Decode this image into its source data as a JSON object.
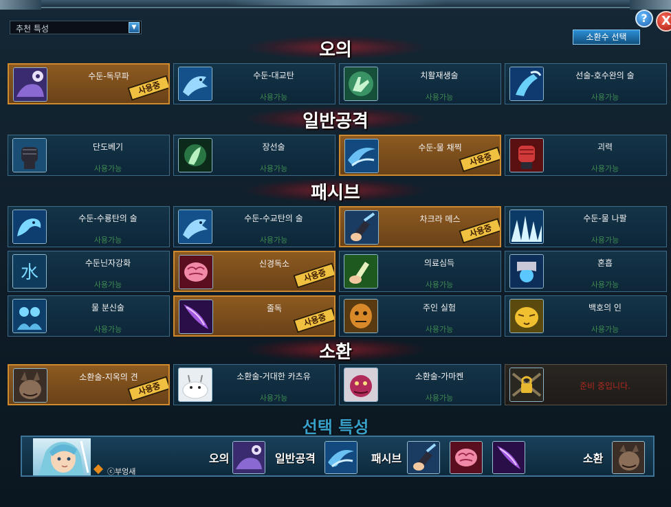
{
  "header": {
    "dropdown_value": "추천 특성",
    "summon_button": "소환수 선택",
    "help_symbol": "?",
    "close_symbol": "X"
  },
  "sections": [
    {
      "title": "오의",
      "cards": [
        {
          "name": "수둔-독무파",
          "status": "사용중",
          "used": true,
          "icon": "purple-yin-yang-icon"
        },
        {
          "name": "수둔-대교탄",
          "status": "사용가능",
          "used": false,
          "icon": "water-shark-icon"
        },
        {
          "name": "치활재생술",
          "status": "사용가능",
          "used": false,
          "icon": "green-healing-hand-icon"
        },
        {
          "name": "선술-호수완의 술",
          "status": "사용가능",
          "used": false,
          "icon": "water-arm-icon"
        }
      ]
    },
    {
      "title": "일반공격",
      "cards": [
        {
          "name": "단도베기",
          "status": "사용가능",
          "used": false,
          "icon": "fist-icon"
        },
        {
          "name": "장선술",
          "status": "사용가능",
          "used": false,
          "icon": "green-palm-icon"
        },
        {
          "name": "수둔-물 채찍",
          "status": "사용중",
          "used": true,
          "icon": "water-whip-icon"
        },
        {
          "name": "괴력",
          "status": "사용가능",
          "used": false,
          "icon": "red-fist-icon"
        }
      ]
    },
    {
      "title": "패시브",
      "cards": [
        {
          "name": "수둔-수룡탄의 술",
          "status": "사용가능",
          "used": false,
          "icon": "water-dragon-icon"
        },
        {
          "name": "수둔-수교탄의 술",
          "status": "사용가능",
          "used": false,
          "icon": "water-shark-icon"
        },
        {
          "name": "차크라 메스",
          "status": "사용중",
          "used": true,
          "icon": "chakra-scalpel-icon"
        },
        {
          "name": "수둔-물 나팔",
          "status": "사용가능",
          "used": false,
          "icon": "ice-spikes-icon"
        },
        {
          "name": "수둔닌자강화",
          "status": "사용가능",
          "used": false,
          "icon": "water-kanji-icon"
        },
        {
          "name": "신경독소",
          "status": "사용중",
          "used": true,
          "icon": "pink-brain-icon"
        },
        {
          "name": "의료심득",
          "status": "사용가능",
          "used": false,
          "icon": "green-hand-icon"
        },
        {
          "name": "혼흡",
          "status": "사용가능",
          "used": false,
          "icon": "blue-orb-hand-icon"
        },
        {
          "name": "물 분신술",
          "status": "사용가능",
          "used": false,
          "icon": "water-clone-icon"
        },
        {
          "name": "줄독",
          "status": "사용중",
          "used": true,
          "icon": "purple-blade-icon"
        },
        {
          "name": "주인 실험",
          "status": "사용가능",
          "used": false,
          "icon": "orange-mask-icon"
        },
        {
          "name": "백호의 인",
          "status": "사용가능",
          "used": false,
          "icon": "golden-tiger-icon"
        }
      ]
    },
    {
      "title": "소환",
      "cards": [
        {
          "name": "소환술-지옥의 견",
          "status": "사용중",
          "used": true,
          "icon": "hell-hound-icon"
        },
        {
          "name": "소환술-거대한 카츠유",
          "status": "사용가능",
          "used": false,
          "icon": "katsuyu-slug-icon"
        },
        {
          "name": "소환술-가마켄",
          "status": "사용가능",
          "used": false,
          "icon": "gamaken-toad-icon"
        },
        {
          "name": "",
          "status": "준비 중입니다.",
          "used": false,
          "locked": true,
          "icon": "chain-lock-icon"
        }
      ]
    }
  ],
  "selected": {
    "title": "선택 특성",
    "label_ougi": "오의",
    "label_attack": "일반공격",
    "label_passive": "패시브",
    "label_summon": "소환",
    "copyright": "ⓒ부엉새"
  },
  "colors": {
    "used_bg": "#8d5a20",
    "used_border": "#d08a2e",
    "available_bg": "#143448",
    "status_available": "#3f8a52",
    "locked_text": "#b22a20",
    "selected_title": "#38a0c8"
  }
}
